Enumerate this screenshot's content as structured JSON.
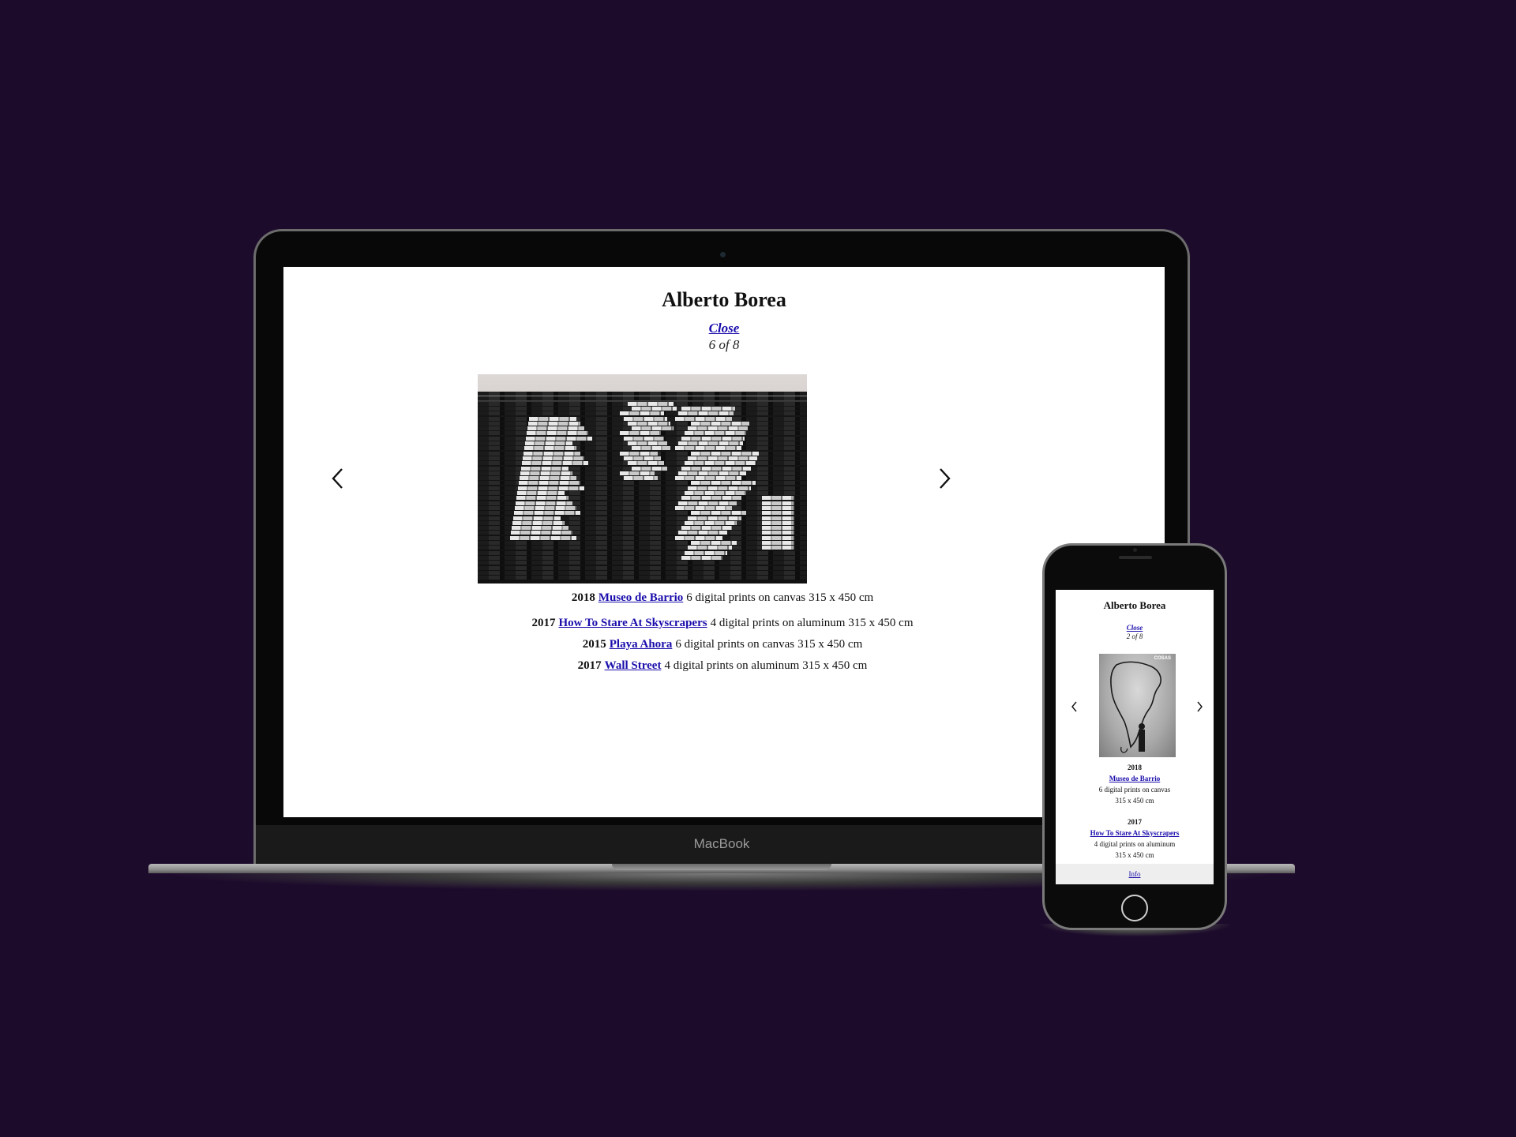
{
  "laptop": {
    "brand_label": "MacBook",
    "page": {
      "title": "Alberto Borea",
      "close_label": "Close",
      "counter": "6 of 8",
      "prev_icon": "chevron-left-icon",
      "next_icon": "chevron-right-icon",
      "works": [
        {
          "year": "2018",
          "title": "Museo de Barrio",
          "medium": "6 digital prints on canvas",
          "size": "315 x 450 cm"
        },
        {
          "year": "2017",
          "title": "How To Stare At Skyscrapers",
          "medium": "4 digital prints on aluminum",
          "size": "315 x 450 cm"
        },
        {
          "year": "2015",
          "title": "Playa Ahora",
          "medium": "6 digital prints on canvas",
          "size": "315 x 450 cm"
        },
        {
          "year": "2017",
          "title": "Wall Street",
          "medium": "4 digital prints on aluminum",
          "size": "315 x 450 cm"
        }
      ]
    }
  },
  "phone": {
    "page": {
      "title": "Alberto Borea",
      "close_label": "Close",
      "counter": "2 of 8",
      "image_brand": "COSAS",
      "prev_icon": "chevron-left-icon",
      "next_icon": "chevron-right-icon",
      "works": [
        {
          "year": "2018",
          "title": "Museo de Barrio",
          "medium": "6 digital prints on canvas",
          "size": "315 x 450 cm"
        },
        {
          "year": "2017",
          "title": "How To Stare At Skyscrapers",
          "medium": "4 digital prints on aluminum",
          "size": "315 x 450 cm"
        }
      ],
      "footer_link": "Info"
    }
  },
  "colors": {
    "background": "#1d0b2c",
    "link": "#1a0dab"
  }
}
